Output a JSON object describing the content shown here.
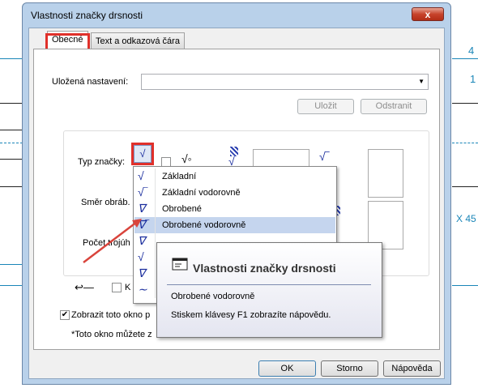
{
  "window": {
    "title": "Vlastnosti značky drsnosti",
    "close_label": "x"
  },
  "background_text": {
    "right_top": "4",
    "right_mid": "1",
    "right_label": "X 45"
  },
  "tabs": [
    {
      "label": "Obecné",
      "active": true
    },
    {
      "label": "Text a odkazová čára",
      "active": false
    }
  ],
  "general": {
    "saved_settings_label": "Uložená nastavení:",
    "saved_settings_value": "",
    "save_button": "Uložit",
    "remove_button": "Odstranit",
    "symbol_type_label": "Typ značky:",
    "lay_direction_label": "Směr obráb.",
    "triple_count_label": "Počet trojúh",
    "show_window_label": "Zobrazit toto okno p",
    "show_window_checked": true,
    "note_text": "*Toto okno můžete z",
    "k_checkbox_label": "K"
  },
  "dropdown": {
    "items": [
      {
        "label": "Základní",
        "icon": "√"
      },
      {
        "label": "Základní vodorovně",
        "icon": "√‾"
      },
      {
        "label": "Obrobené",
        "icon": "∇"
      },
      {
        "label": "Obrobené vodorovně",
        "icon": "∇‾",
        "selected": true
      },
      {
        "label": "",
        "icon": "∇"
      },
      {
        "label": "",
        "icon": "√"
      },
      {
        "label": "",
        "icon": "∇"
      },
      {
        "label": "",
        "icon": "∼"
      }
    ]
  },
  "tooltip": {
    "title": "Vlastnosti značky drsnosti",
    "subtitle": "Obrobené vodorovně",
    "help": "Stiskem klávesy F1 zobrazíte nápovědu."
  },
  "footer": {
    "ok": "OK",
    "cancel": "Storno",
    "help": "Nápověda"
  },
  "colors": {
    "highlight": "#e0302a",
    "arrow": "#d9443c",
    "accent": "#1b2e9e"
  }
}
